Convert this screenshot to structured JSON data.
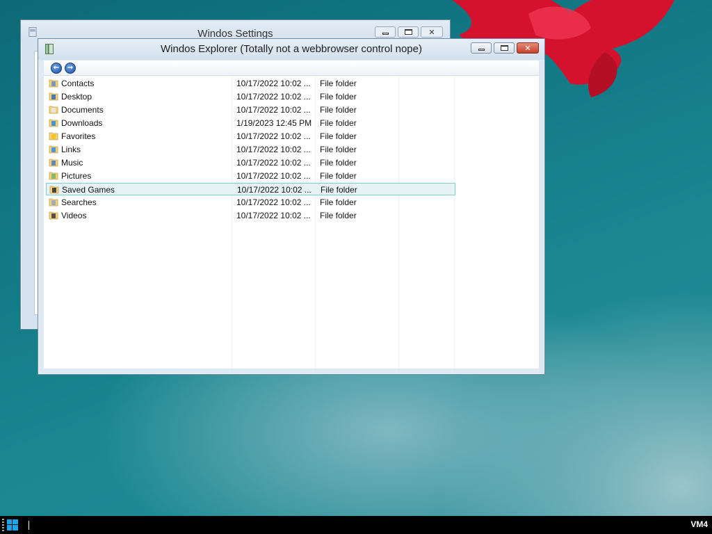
{
  "settings_window": {
    "title": "Windos Settings"
  },
  "explorer_window": {
    "title": "Windos Explorer (Totally not a webbrowser control nope)",
    "nav": {
      "back_icon": "back-arrow-icon",
      "forward_icon": "forward-arrow-icon"
    },
    "files": [
      {
        "name": "Contacts",
        "date": "10/17/2022 10:02 ...",
        "type": "File folder",
        "icon": "contacts-folder-icon"
      },
      {
        "name": "Desktop",
        "date": "10/17/2022 10:02 ...",
        "type": "File folder",
        "icon": "desktop-folder-icon"
      },
      {
        "name": "Documents",
        "date": "10/17/2022 10:02 ...",
        "type": "File folder",
        "icon": "documents-folder-icon"
      },
      {
        "name": "Downloads",
        "date": "1/19/2023 12:45 PM",
        "type": "File folder",
        "icon": "downloads-folder-icon"
      },
      {
        "name": "Favorites",
        "date": "10/17/2022 10:02 ...",
        "type": "File folder",
        "icon": "favorites-folder-icon"
      },
      {
        "name": "Links",
        "date": "10/17/2022 10:02 ...",
        "type": "File folder",
        "icon": "links-folder-icon"
      },
      {
        "name": "Music",
        "date": "10/17/2022 10:02 ...",
        "type": "File folder",
        "icon": "music-folder-icon"
      },
      {
        "name": "Pictures",
        "date": "10/17/2022 10:02 ...",
        "type": "File folder",
        "icon": "pictures-folder-icon"
      },
      {
        "name": "Saved Games",
        "date": "10/17/2022 10:02 ...",
        "type": "File folder",
        "icon": "saved-games-folder-icon",
        "selected": true
      },
      {
        "name": "Searches",
        "date": "10/17/2022 10:02 ...",
        "type": "File folder",
        "icon": "searches-folder-icon"
      },
      {
        "name": "Videos",
        "date": "10/17/2022 10:02 ...",
        "type": "File folder",
        "icon": "videos-folder-icon"
      }
    ]
  },
  "taskbar": {
    "tray_label": "VM4",
    "start_icon": "windows-start-icon"
  },
  "colors": {
    "selection_bg": "#e5f3f7",
    "selection_border": "#7ecbd9",
    "close_button": "#c3432c",
    "taskbar": "#000000"
  }
}
